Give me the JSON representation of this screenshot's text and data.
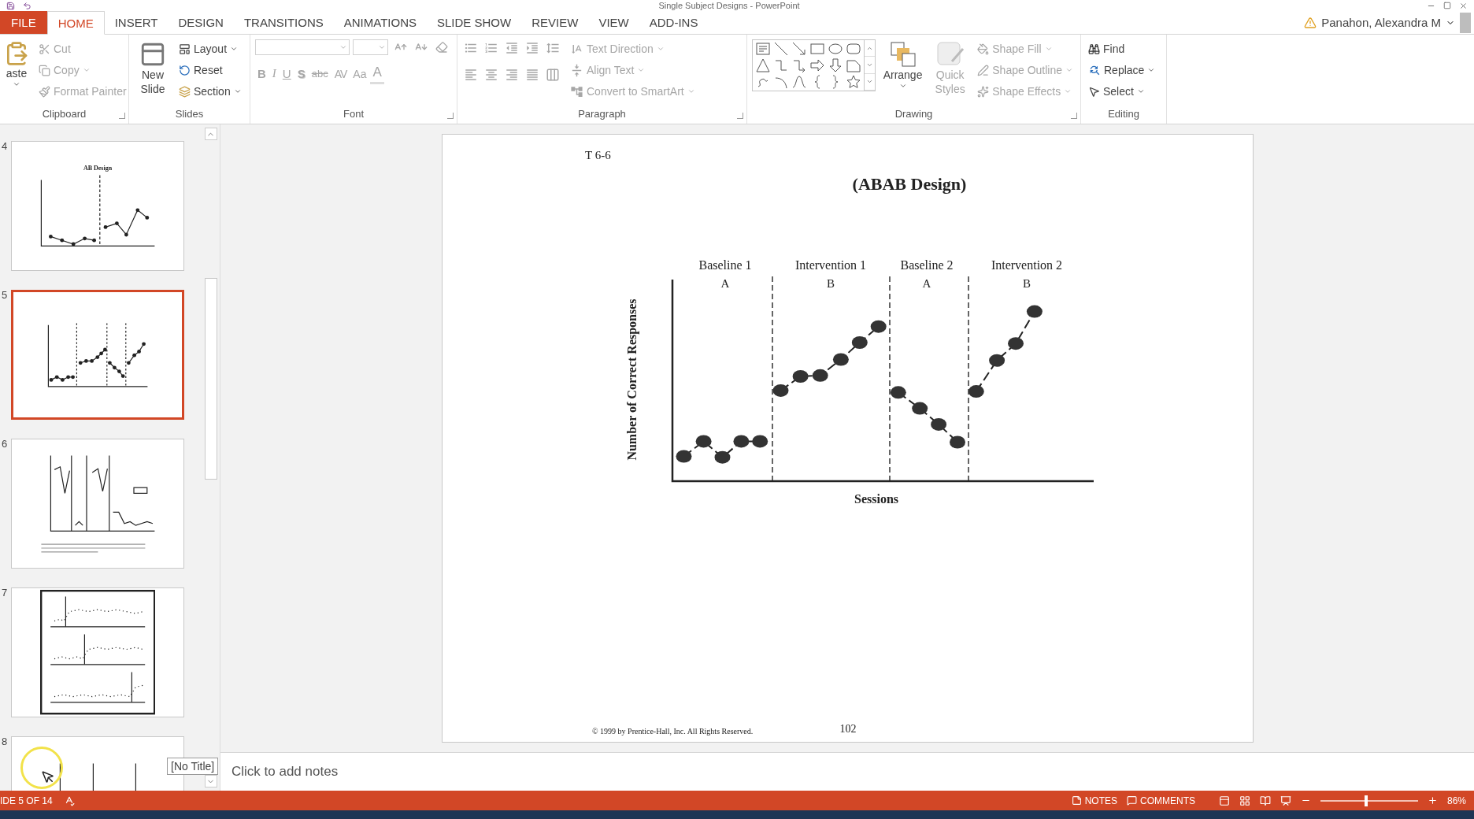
{
  "window": {
    "title": "Single Subject Designs - PowerPoint"
  },
  "tabs": [
    {
      "label": "FILE",
      "kind": "file",
      "selected": false
    },
    {
      "label": "HOME",
      "kind": "tab",
      "selected": true
    },
    {
      "label": "INSERT",
      "kind": "tab",
      "selected": false
    },
    {
      "label": "DESIGN",
      "kind": "tab",
      "selected": false
    },
    {
      "label": "TRANSITIONS",
      "kind": "tab",
      "selected": false
    },
    {
      "label": "ANIMATIONS",
      "kind": "tab",
      "selected": false
    },
    {
      "label": "SLIDE SHOW",
      "kind": "tab",
      "selected": false
    },
    {
      "label": "REVIEW",
      "kind": "tab",
      "selected": false
    },
    {
      "label": "VIEW",
      "kind": "tab",
      "selected": false
    },
    {
      "label": "ADD-INS",
      "kind": "tab",
      "selected": false
    }
  ],
  "account": {
    "name": "Panahon, Alexandra M"
  },
  "ribbon": {
    "clipboard": {
      "label": "Clipboard",
      "paste": {
        "label": "aste"
      },
      "cut": {
        "label": "Cut",
        "disabled": true
      },
      "copy": {
        "label": "Copy",
        "disabled": true
      },
      "format_painter": {
        "label": "Format Painter",
        "disabled": true
      }
    },
    "slides": {
      "label": "Slides",
      "new_slide": {
        "label": "New Slide"
      },
      "layout": {
        "label": "Layout"
      },
      "reset": {
        "label": "Reset"
      },
      "section": {
        "label": "Section"
      }
    },
    "font": {
      "label": "Font",
      "disabled": true,
      "format_buttons": [
        {
          "label": "B",
          "kind": "bold"
        },
        {
          "label": "I",
          "kind": "italic"
        },
        {
          "label": "U",
          "kind": "underline"
        },
        {
          "label": "S",
          "kind": "shadow"
        },
        {
          "label": "abc",
          "kind": "strike"
        },
        {
          "label": "AV",
          "kind": "spacing"
        },
        {
          "label": "Aa",
          "kind": "case"
        }
      ],
      "color_button": {
        "label": "A"
      }
    },
    "paragraph": {
      "label": "Paragraph",
      "text_direction": {
        "label": "Text Direction",
        "disabled": true
      },
      "align_text": {
        "label": "Align Text",
        "disabled": true
      },
      "smartart": {
        "label": "Convert to SmartArt",
        "disabled": true
      }
    },
    "drawing": {
      "label": "Drawing",
      "arrange": {
        "label": "Arrange"
      },
      "quick_styles": {
        "label": "Quick Styles",
        "disabled": true
      },
      "shape_fill": {
        "label": "Shape Fill",
        "disabled": true
      },
      "shape_outline": {
        "label": "Shape Outline",
        "disabled": true
      },
      "shape_effects": {
        "label": "Shape Effects",
        "disabled": true
      }
    },
    "editing": {
      "label": "Editing",
      "find": {
        "label": "Find"
      },
      "replace": {
        "label": "Replace"
      },
      "select": {
        "label": "Select"
      }
    }
  },
  "thumbnails": [
    {
      "number": "4",
      "kind": "ab",
      "selected": false,
      "title": "AB Design"
    },
    {
      "number": "5",
      "kind": "abab",
      "selected": true
    },
    {
      "number": "6",
      "kind": "reversal",
      "selected": false
    },
    {
      "number": "7",
      "kind": "panels",
      "selected": false
    },
    {
      "number": "8",
      "kind": "baseline",
      "selected": false
    }
  ],
  "tooltip": {
    "text": "[No Title]"
  },
  "slide": {
    "label": "T 6-6",
    "title": "(ABAB Design)",
    "chart": {
      "y_label": "Number of Correct Responses",
      "x_label": "Sessions",
      "phases": [
        {
          "label": "Baseline 1",
          "letter": "A"
        },
        {
          "label": "Intervention 1",
          "letter": "B"
        },
        {
          "label": "Baseline 2",
          "letter": "A"
        },
        {
          "label": "Intervention 2",
          "letter": "B"
        }
      ]
    },
    "footer": "© 1999 by Prentice-Hall, Inc.  All Rights Reserved.",
    "page_number": "102"
  },
  "notes": {
    "placeholder": "Click to add notes"
  },
  "status_bar": {
    "slide_counter": "IDE 5 OF 14",
    "notes": "NOTES",
    "comments": "COMMENTS",
    "zoom": {
      "level": 0.47,
      "reading": "86%"
    }
  }
}
